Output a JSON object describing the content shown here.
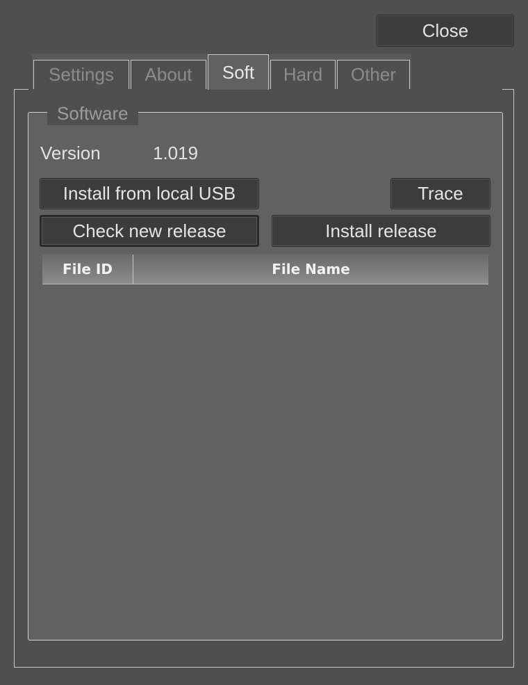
{
  "toolbar": {
    "close_label": "Close"
  },
  "tabs": [
    {
      "label": "Settings",
      "active": false
    },
    {
      "label": "About",
      "active": false
    },
    {
      "label": "Soft",
      "active": true
    },
    {
      "label": "Hard",
      "active": false
    },
    {
      "label": "Other",
      "active": false
    }
  ],
  "software": {
    "group_title": "Software",
    "version_label": "Version",
    "version_value": "1.019",
    "buttons": {
      "install_usb": "Install from local USB",
      "trace": "Trace",
      "check_release": "Check new release",
      "install_release": "Install release"
    },
    "table": {
      "columns": [
        "File ID",
        "File Name"
      ],
      "rows": []
    }
  }
}
